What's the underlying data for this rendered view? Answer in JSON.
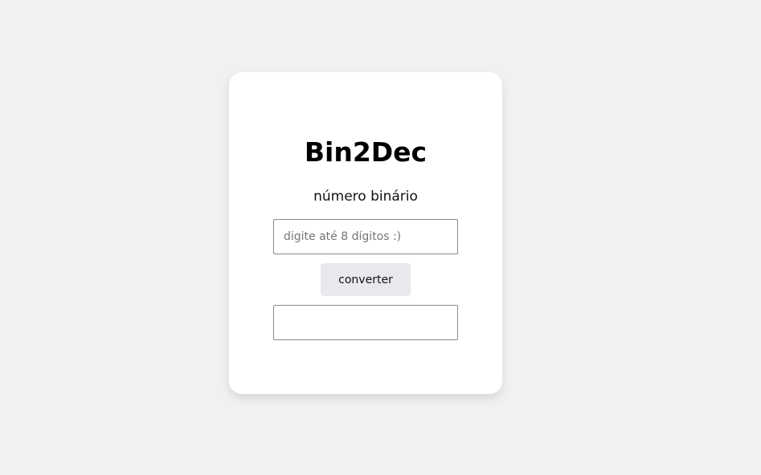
{
  "app": {
    "title": "Bin2Dec",
    "label": "número binário"
  },
  "binary_input": {
    "value": "",
    "placeholder": "digite até 8 dígitos :)"
  },
  "convert_button": {
    "label": "converter"
  },
  "result_output": {
    "value": ""
  },
  "colors": {
    "background": "#f1f1f1",
    "card": "#ffffff",
    "button": "#e9e9ed",
    "border": "#8a8a8a"
  }
}
